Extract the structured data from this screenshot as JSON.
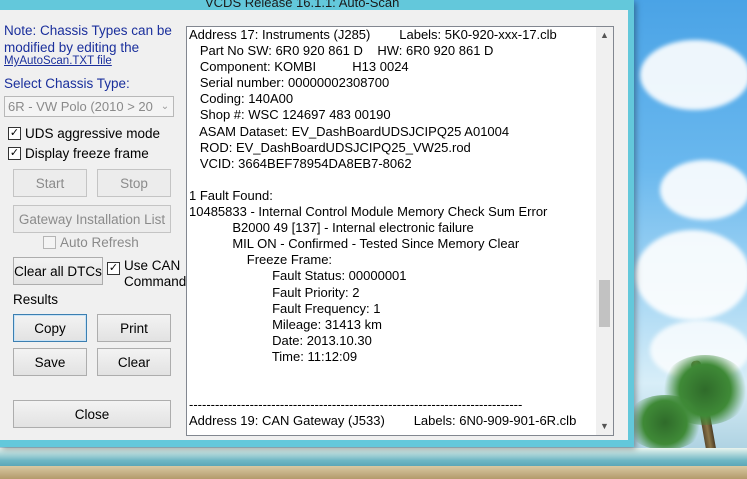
{
  "window": {
    "title": "VCDS Release 16.1.1: Auto-Scan"
  },
  "left_panel": {
    "note": "Note:  Chassis Types can be modified by editing the",
    "note_link": "MyAutoScan.TXT file",
    "chassis_label": "Select Chassis Type:",
    "chassis_value": "6R - VW Polo (2010 > 20",
    "uds_label": "UDS aggressive mode",
    "freeze_label": "Display freeze frame",
    "start": "Start",
    "stop": "Stop",
    "gateway": "Gateway Installation List",
    "auto_refresh": "Auto Refresh",
    "clear_dtcs": "Clear all DTCs",
    "use_can": "Use CAN\nCommand",
    "results_label": "Results",
    "copy": "Copy",
    "print": "Print",
    "save": "Save",
    "clear": "Clear",
    "close": "Close"
  },
  "results": {
    "lines": [
      "Address 17: Instruments (J285)        Labels: 5K0-920-xxx-17.clb",
      "   Part No SW: 6R0 920 861 D    HW: 6R0 920 861 D",
      "   Component: KOMBI          H13 0024",
      "   Serial number: 00000002308700",
      "   Coding: 140A00",
      "   Shop #: WSC 124697 483 00190",
      "   ASAM Dataset: EV_DashBoardUDSJCIPQ25 A01004",
      "   ROD: EV_DashBoardUDSJCIPQ25_VW25.rod",
      "   VCID: 3664BEF78954DA8EB7-8062",
      "",
      "1 Fault Found:",
      "10485833 - Internal Control Module Memory Check Sum Error",
      "            B2000 49 [137] - Internal electronic failure",
      "            MIL ON - Confirmed - Tested Since Memory Clear",
      "                Freeze Frame:",
      "                       Fault Status: 00000001",
      "                       Fault Priority: 2",
      "                       Fault Frequency: 1",
      "                       Mileage: 31413 km",
      "                       Date: 2013.10.30",
      "                       Time: 11:12:09",
      "",
      "",
      "-----------------------------------------------------------------------------",
      "Address 19: CAN Gateway (J533)        Labels: 6N0-909-901-6R.clb"
    ]
  },
  "icons": {
    "scroll_up": "chevron-up-icon",
    "scroll_down": "chevron-down-icon",
    "combo_arrow": "chevron-down-icon",
    "check": "checkmark-icon"
  }
}
